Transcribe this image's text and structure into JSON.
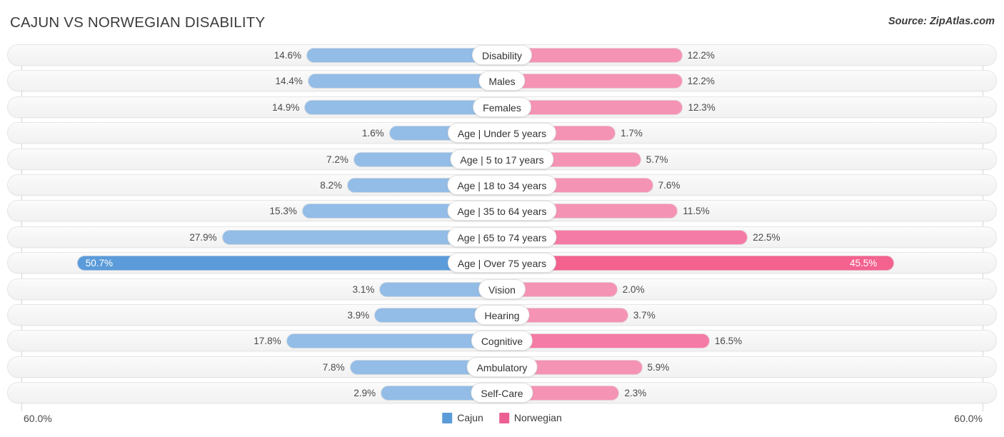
{
  "header": {
    "title": "CAJUN VS NORWEGIAN DISABILITY",
    "source": "Source: ZipAtlas.com"
  },
  "legend": {
    "items": [
      {
        "label": "Cajun",
        "color": "#5b9bd9"
      },
      {
        "label": "Norwegian",
        "color": "#ec5f93"
      }
    ]
  },
  "axis": {
    "left_label": "60.0%",
    "right_label": "60.0%",
    "max": 60.0
  },
  "chart_data": {
    "type": "bar",
    "title": "CAJUN VS NORWEGIAN DISABILITY",
    "subtitle": "Source: ZipAtlas.com",
    "orientation": "horizontal-diverging",
    "xlabel": "",
    "ylabel": "",
    "xlim": [
      60.0,
      60.0
    ],
    "grid": true,
    "legend_position": "bottom-center",
    "categories": [
      "Disability",
      "Males",
      "Females",
      "Age | Under 5 years",
      "Age | 5 to 17 years",
      "Age | 18 to 34 years",
      "Age | 35 to 64 years",
      "Age | 65 to 74 years",
      "Age | Over 75 years",
      "Vision",
      "Hearing",
      "Cognitive",
      "Ambulatory",
      "Self-Care"
    ],
    "series": [
      {
        "name": "Cajun",
        "color": "#93bce6",
        "values": [
          14.6,
          14.4,
          14.9,
          1.6,
          7.2,
          8.2,
          15.3,
          27.9,
          50.7,
          3.1,
          3.9,
          17.8,
          7.8,
          2.9
        ]
      },
      {
        "name": "Norwegian",
        "color": "#f593b5",
        "values": [
          12.2,
          12.2,
          12.3,
          1.7,
          5.7,
          7.6,
          11.5,
          22.5,
          45.5,
          2.0,
          3.7,
          16.5,
          5.9,
          2.3
        ]
      }
    ]
  },
  "rows": [
    {
      "label": "Disability",
      "left_value": "14.6%",
      "right_value": "12.2%",
      "left": 14.6,
      "right": 12.2,
      "style": ""
    },
    {
      "label": "Males",
      "left_value": "14.4%",
      "right_value": "12.2%",
      "left": 14.4,
      "right": 12.2,
      "style": ""
    },
    {
      "label": "Females",
      "left_value": "14.9%",
      "right_value": "12.3%",
      "left": 14.9,
      "right": 12.3,
      "style": ""
    },
    {
      "label": "Age | Under 5 years",
      "left_value": "1.6%",
      "right_value": "1.7%",
      "left": 1.6,
      "right": 1.7,
      "style": ""
    },
    {
      "label": "Age | 5 to 17 years",
      "left_value": "7.2%",
      "right_value": "5.7%",
      "left": 7.2,
      "right": 5.7,
      "style": ""
    },
    {
      "label": "Age | 18 to 34 years",
      "left_value": "8.2%",
      "right_value": "7.6%",
      "left": 8.2,
      "right": 7.6,
      "style": ""
    },
    {
      "label": "Age | 35 to 64 years",
      "left_value": "15.3%",
      "right_value": "11.5%",
      "left": 15.3,
      "right": 11.5,
      "style": ""
    },
    {
      "label": "Age | 65 to 74 years",
      "left_value": "27.9%",
      "right_value": "22.5%",
      "left": 27.9,
      "right": 22.5,
      "style": "mid"
    },
    {
      "label": "Age | Over 75 years",
      "left_value": "50.7%",
      "right_value": "45.5%",
      "left": 50.7,
      "right": 45.5,
      "style": "emph"
    },
    {
      "label": "Vision",
      "left_value": "3.1%",
      "right_value": "2.0%",
      "left": 3.1,
      "right": 2.0,
      "style": ""
    },
    {
      "label": "Hearing",
      "left_value": "3.9%",
      "right_value": "3.7%",
      "left": 3.9,
      "right": 3.7,
      "style": ""
    },
    {
      "label": "Cognitive",
      "left_value": "17.8%",
      "right_value": "16.5%",
      "left": 17.8,
      "right": 16.5,
      "style": "mid"
    },
    {
      "label": "Ambulatory",
      "left_value": "7.8%",
      "right_value": "5.9%",
      "left": 7.8,
      "right": 5.9,
      "style": ""
    },
    {
      "label": "Self-Care",
      "left_value": "2.9%",
      "right_value": "2.3%",
      "left": 2.9,
      "right": 2.3,
      "style": ""
    }
  ]
}
